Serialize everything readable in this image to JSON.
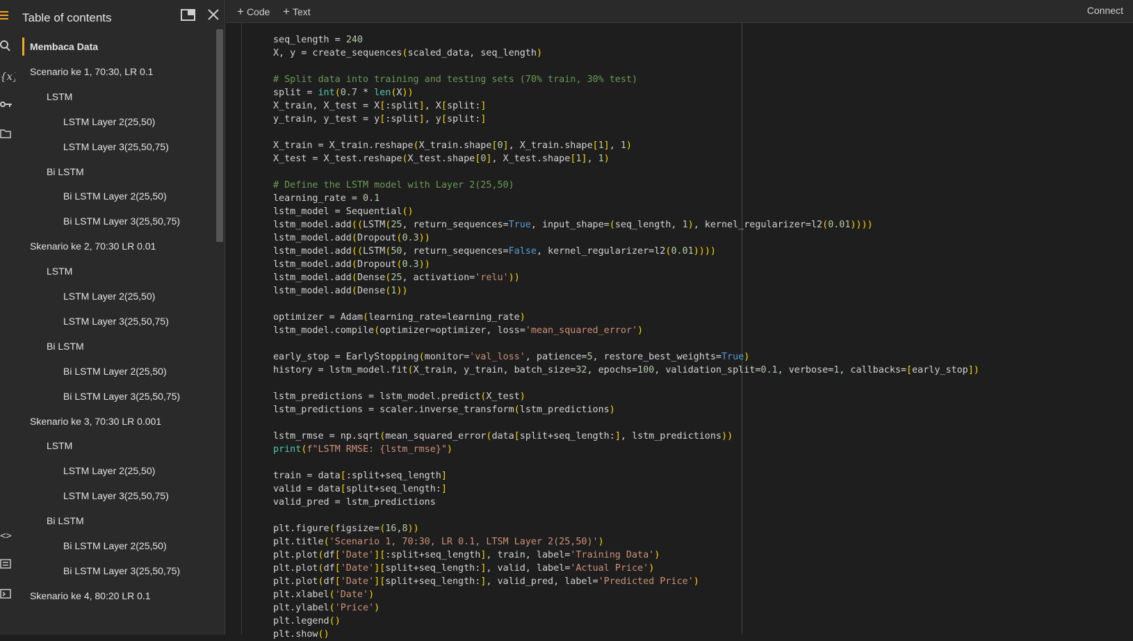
{
  "toolbar": {
    "add_code": "Code",
    "add_text": "Text",
    "connect": "Connect"
  },
  "toc": {
    "title": "Table of contents",
    "items": [
      {
        "label": "Membaca Data",
        "level": 0,
        "active": true
      },
      {
        "label": "Scenario ke 1, 70:30, LR 0.1",
        "level": 0
      },
      {
        "label": "LSTM",
        "level": 1
      },
      {
        "label": "LSTM Layer 2(25,50)",
        "level": 2
      },
      {
        "label": "LSTM Layer 3(25,50,75)",
        "level": 2
      },
      {
        "label": "Bi LSTM",
        "level": 1
      },
      {
        "label": "Bi LSTM Layer 2(25,50)",
        "level": 2
      },
      {
        "label": "Bi LSTM Layer 3(25,50,75)",
        "level": 2
      },
      {
        "label": "Skenario ke 2, 70:30 LR 0.01",
        "level": 0
      },
      {
        "label": "LSTM",
        "level": 1
      },
      {
        "label": "LSTM Layer 2(25,50)",
        "level": 2
      },
      {
        "label": "LSTM Layer 3(25,50,75)",
        "level": 2
      },
      {
        "label": "Bi LSTM",
        "level": 1
      },
      {
        "label": "Bi LSTM Layer 2(25,50)",
        "level": 2
      },
      {
        "label": "Bi LSTM Layer 3(25,50,75)",
        "level": 2
      },
      {
        "label": "Skenario ke 3, 70:30 LR 0.001",
        "level": 0
      },
      {
        "label": "LSTM",
        "level": 1
      },
      {
        "label": "LSTM Layer 2(25,50)",
        "level": 2
      },
      {
        "label": "LSTM Layer 3(25,50,75)",
        "level": 2
      },
      {
        "label": "Bi LSTM",
        "level": 1
      },
      {
        "label": "Bi LSTM Layer 2(25,50)",
        "level": 2
      },
      {
        "label": "Bi LSTM Layer 3(25,50,75)",
        "level": 2
      },
      {
        "label": "Skenario ke 4, 80:20 LR 0.1",
        "level": 0
      }
    ]
  },
  "code_lines": [
    "seq_length = 240",
    "X, y = create_sequences(scaled_data, seq_length)",
    "",
    "# Split data into training and testing sets (70% train, 30% test)",
    "split = int(0.7 * len(X))",
    "X_train, X_test = X[:split], X[split:]",
    "y_train, y_test = y[:split], y[split:]",
    "",
    "X_train = X_train.reshape(X_train.shape[0], X_train.shape[1], 1)",
    "X_test = X_test.reshape(X_test.shape[0], X_test.shape[1], 1)",
    "",
    "# Define the LSTM model with Layer 2(25,50)",
    "learning_rate = 0.1",
    "lstm_model = Sequential()",
    "lstm_model.add((LSTM(25, return_sequences=True, input_shape=(seq_length, 1), kernel_regularizer=l2(0.01))))",
    "lstm_model.add(Dropout(0.3))",
    "lstm_model.add((LSTM(50, return_sequences=False, kernel_regularizer=l2(0.01))))",
    "lstm_model.add(Dropout(0.3))",
    "lstm_model.add(Dense(25, activation='relu'))",
    "lstm_model.add(Dense(1))",
    "",
    "optimizer = Adam(learning_rate=learning_rate)",
    "lstm_model.compile(optimizer=optimizer, loss='mean_squared_error')",
    "",
    "early_stop = EarlyStopping(monitor='val_loss', patience=5, restore_best_weights=True)",
    "history = lstm_model.fit(X_train, y_train, batch_size=32, epochs=100, validation_split=0.1, verbose=1, callbacks=[early_stop])",
    "",
    "lstm_predictions = lstm_model.predict(X_test)",
    "lstm_predictions = scaler.inverse_transform(lstm_predictions)",
    "",
    "lstm_rmse = np.sqrt(mean_squared_error(data[split+seq_length:], lstm_predictions))",
    "print(f\"LSTM RMSE: {lstm_rmse}\")",
    "",
    "train = data[:split+seq_length]",
    "valid = data[split+seq_length:]",
    "valid_pred = lstm_predictions",
    "",
    "plt.figure(figsize=(16,8))",
    "plt.title('Scenario 1, 70:30, LR 0.1, LTSM Layer 2(25,50)')",
    "plt.plot(df['Date'][:split+seq_length], train, label='Training Data')",
    "plt.plot(df['Date'][split+seq_length:], valid, label='Actual Price')",
    "plt.plot(df['Date'][split+seq_length:], valid_pred, label='Predicted Price')",
    "plt.xlabel('Date')",
    "plt.ylabel('Price')",
    "plt.legend()",
    "plt.show()"
  ]
}
